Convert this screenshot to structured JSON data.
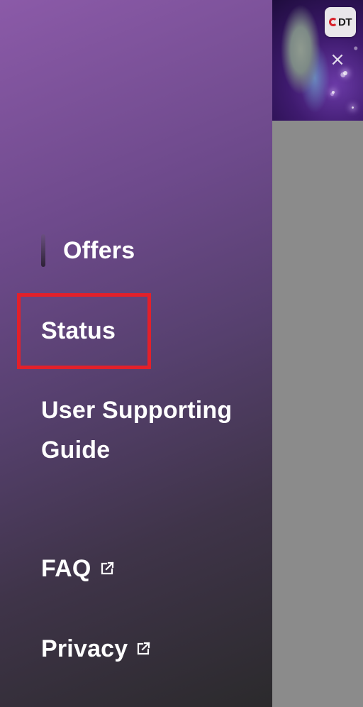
{
  "drawer": {
    "items": [
      {
        "label": "Offers",
        "active": true
      },
      {
        "label": "Status"
      },
      {
        "label": "User Supporting Guide"
      },
      {
        "label": "FAQ",
        "external": true
      },
      {
        "label": "Privacy",
        "external": true
      }
    ]
  },
  "header": {
    "brand_logo_text": "DT",
    "close_symbol": "×"
  },
  "annotation": {
    "highlighted_item": "Status",
    "color": "#e3202a"
  },
  "icons": {
    "external_link": "external-link-icon",
    "close": "close-icon"
  }
}
